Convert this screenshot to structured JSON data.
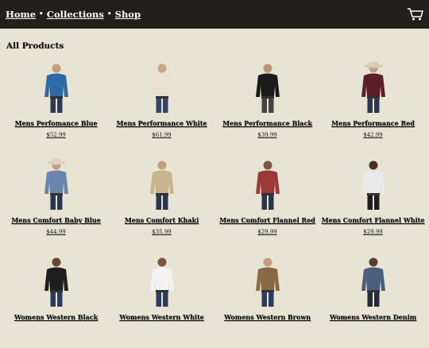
{
  "nav": {
    "breadcrumb": [
      "Home",
      "Collections",
      "Shop"
    ],
    "separator": "•",
    "cart_icon": "cart-icon"
  },
  "page": {
    "title": "All Products"
  },
  "products": [
    {
      "name": "Mens Perfomance Blue",
      "price": "$52.99",
      "shirt": "#2e6aa6",
      "pants": "#2c3a55",
      "skin": "#c99c7d",
      "hat": ""
    },
    {
      "name": "Mens Performance White",
      "price": "$61.99",
      "shirt": "#e9e2cf",
      "pants": "#34446a",
      "skin": "#caa284",
      "hat": ""
    },
    {
      "name": "Mens Performance Black",
      "price": "$39.99",
      "shirt": "#1a1a1a",
      "pants": "#444",
      "skin": "#bf9476",
      "hat": ""
    },
    {
      "name": "Mens Performance Red",
      "price": "$42.99",
      "shirt": "#5b1e2a",
      "pants": "#2a3450",
      "skin": "#c49a7c",
      "hat": "#d8ccb5"
    },
    {
      "name": "Mens Comfort Baby Blue",
      "price": "$44.99",
      "shirt": "#6b86ad",
      "pants": "#293755",
      "skin": "#c69b7d",
      "hat": "#ddd3c0"
    },
    {
      "name": "Mens Comfort Khaki",
      "price": "$35.99",
      "shirt": "#c7b48c",
      "pants": "#2b3650",
      "skin": "#c69c7e",
      "hat": ""
    },
    {
      "name": "Mens Comfort Flannel Red",
      "price": "$29.99",
      "shirt": "#9b3838",
      "pants": "#2a3550",
      "skin": "#7a5440",
      "hat": ""
    },
    {
      "name": "Mens Comfort Flannel White",
      "price": "$29.99",
      "shirt": "#e9e9e9",
      "pants": "#1d1d1d",
      "skin": "#4b3024",
      "hat": ""
    },
    {
      "name": "Womens Western Black",
      "price": "",
      "shirt": "#1e1e1e",
      "pants": "#2d3b5c",
      "skin": "#6a4532",
      "hat": ""
    },
    {
      "name": "Womens Western White",
      "price": "",
      "shirt": "#f2f2f2",
      "pants": "#2d3b5c",
      "skin": "#7c5240",
      "hat": ""
    },
    {
      "name": "Womens Western Brown",
      "price": "",
      "shirt": "#8a6a43",
      "pants": "#2d3b5c",
      "skin": "#c49c80",
      "hat": ""
    },
    {
      "name": "Womens Western Denim",
      "price": "",
      "shirt": "#4b5e7d",
      "pants": "#222a3e",
      "skin": "#5e3e30",
      "hat": ""
    }
  ]
}
